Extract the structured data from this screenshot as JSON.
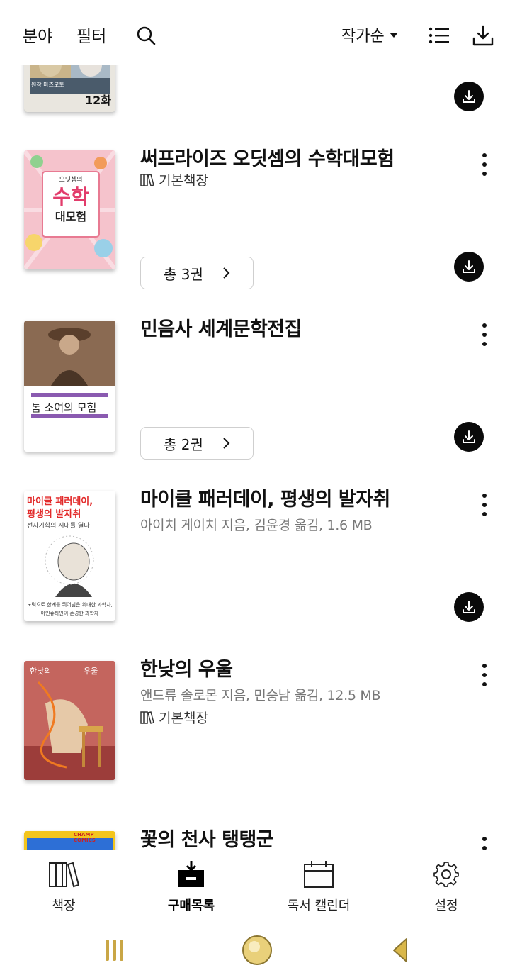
{
  "toolbar": {
    "category_label": "분야",
    "filter_label": "필터",
    "sort_label": "작가순"
  },
  "colors": {
    "accent_dark": "#0a0a0a",
    "meta_gray": "#777777",
    "border_gray": "#cfcfcf"
  },
  "books": [
    {
      "title": "",
      "cover_badge": "12화",
      "cover_small": "원작 마츠모토"
    },
    {
      "title": "써프라이즈 오딧셈의 수학대모험",
      "shelf": "기본책장",
      "volumes_label": "총 3권",
      "cover_lines": [
        "오딧셈의",
        "수학",
        "대모험"
      ]
    },
    {
      "title": "민음사 세계문학전집",
      "volumes_label": "총 2권",
      "cover_lines": [
        "톰 소여의 모험"
      ]
    },
    {
      "title": "마이클 패러데이, 평생의 발자취",
      "meta": "아이치 게이치 지음, 김윤경 옮김, 1.6 MB",
      "cover_lines": [
        "마이클 패러데이,",
        "평생의 발자취",
        "전자기학의 시대를 열다",
        "노력으로 한계를 뛰어넘은 위대한 과학자,",
        "아인슈타인이 존경한 과학자"
      ]
    },
    {
      "title": "한낮의 우울",
      "meta": "앤드류 솔로몬 지음, 민승남 옮김, 12.5 MB",
      "shelf": "기본책장",
      "cover_lines": [
        "한낮의",
        "우울"
      ]
    },
    {
      "title": "꽃의 천사 탱탱군",
      "cover_lines": [
        "CHAMP COMICS"
      ]
    }
  ],
  "bottom_nav": [
    {
      "label": "책장",
      "icon": "bookshelf-icon"
    },
    {
      "label": "구매목록",
      "icon": "purchase-box-icon"
    },
    {
      "label": "독서 캘린더",
      "icon": "calendar-icon"
    },
    {
      "label": "설정",
      "icon": "gear-icon"
    }
  ]
}
